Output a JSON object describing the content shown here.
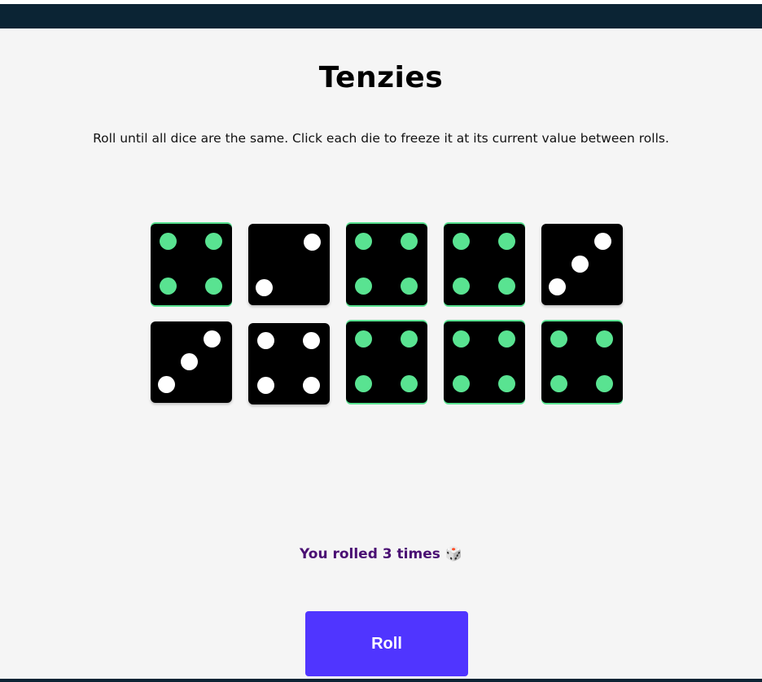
{
  "header": {
    "title": "Tenzies",
    "instructions": "Roll until all dice are the same. Click each die to freeze it at its current value between rolls."
  },
  "dice": [
    {
      "value": 4,
      "held": true
    },
    {
      "value": 2,
      "held": false
    },
    {
      "value": 4,
      "held": true
    },
    {
      "value": 4,
      "held": true
    },
    {
      "value": 3,
      "held": false
    },
    {
      "value": 3,
      "held": false
    },
    {
      "value": 4,
      "held": false
    },
    {
      "value": 4,
      "held": true
    },
    {
      "value": 4,
      "held": true
    },
    {
      "value": 4,
      "held": true
    }
  ],
  "status": {
    "rolls_text": "You rolled 3 times",
    "dice_emoji": "🎲"
  },
  "controls": {
    "roll_label": "Roll"
  },
  "colors": {
    "header_bar": "#0b2434",
    "background": "#f5f5f5",
    "die_face": "#000000",
    "pip_normal": "#ffffff",
    "pip_held": "#59e391",
    "rolls_text": "#4a0f73",
    "roll_button": "#5035ff"
  }
}
